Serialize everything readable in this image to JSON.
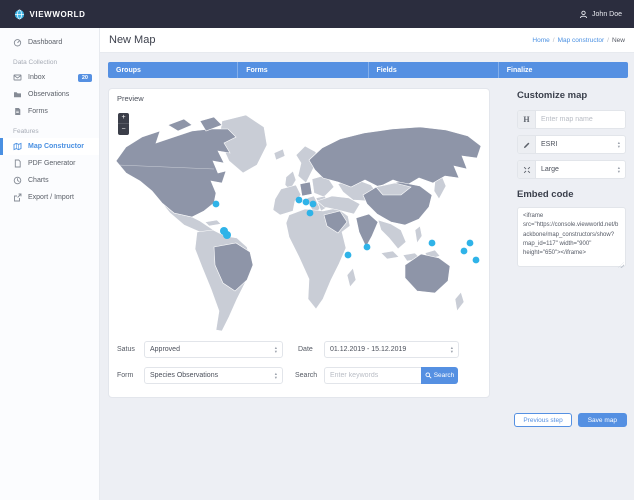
{
  "topbar": {
    "brand": "VIEWWORLD",
    "user": "John Doe"
  },
  "header": {
    "title": "New Map",
    "breadcrumbs": [
      "Home",
      "Map constructor",
      "New"
    ]
  },
  "sidebar": {
    "groups": [
      {
        "title": "",
        "items": [
          {
            "label": "Dashboard",
            "icon": "dashboard-icon"
          }
        ]
      },
      {
        "title": "Data Collection",
        "items": [
          {
            "label": "Inbox",
            "icon": "inbox-icon",
            "badge": "20"
          },
          {
            "label": "Observations",
            "icon": "folder-icon"
          },
          {
            "label": "Forms",
            "icon": "document-icon"
          }
        ]
      },
      {
        "title": "Features",
        "items": [
          {
            "label": "Map Constructor",
            "icon": "map-icon",
            "active": true
          },
          {
            "label": "PDF Generator",
            "icon": "page-icon"
          },
          {
            "label": "Charts",
            "icon": "chart-icon"
          },
          {
            "label": "Export / Import",
            "icon": "export-icon"
          }
        ]
      }
    ]
  },
  "tabs": {
    "items": [
      "Groups",
      "Forms",
      "Fields",
      "Finalize"
    ]
  },
  "map": {
    "preview_label": "Preview",
    "zoom_in": "+",
    "zoom_out": "−",
    "points": [
      [
        106,
        101,
        3.4
      ],
      [
        114,
        128,
        4
      ],
      [
        117,
        132,
        4
      ],
      [
        189,
        97,
        3.4
      ],
      [
        196,
        99,
        3.4
      ],
      [
        203,
        101,
        3.4
      ],
      [
        200,
        110,
        3.4
      ],
      [
        238,
        152,
        3.4
      ],
      [
        257,
        144,
        3.4
      ],
      [
        322,
        140,
        3.4
      ],
      [
        360,
        140,
        3.4
      ],
      [
        354,
        148,
        3.4
      ],
      [
        366,
        157,
        3.4
      ]
    ],
    "filters": {
      "status_label": "Satus",
      "status_value": "Approved",
      "date_label": "Date",
      "date_value": "01.12.2019 - 15.12.2019",
      "form_label": "Form",
      "form_value": "Species Observations",
      "search_label": "Search",
      "search_placeholder": "Enter keywords",
      "search_button": "Search"
    }
  },
  "customize": {
    "title": "Customize map",
    "name_icon": "H",
    "name_placeholder": "Enter map name",
    "basemap_value": "ESRI",
    "size_value": "Large",
    "embed_title": "Embed code",
    "embed_code": "<iframe src=\"https://console.viewworld.net/backbone/map_constructors/show?map_id=117\" width=\"900\" height=\"650\"></iframe>"
  },
  "actions": {
    "previous": "Previous step",
    "save": "Save map"
  },
  "colors": {
    "accent": "#5590e2",
    "point": "#2fb3e8",
    "land_dark": "#8e95a8",
    "land_light": "#c9cdd6",
    "topbar": "#2b2d3e"
  }
}
